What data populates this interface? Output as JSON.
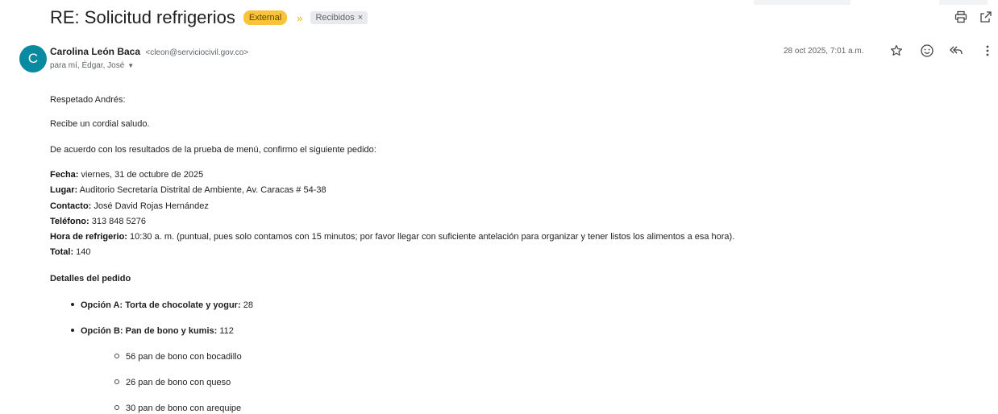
{
  "email": {
    "subject": "RE: Solicitud refrigerios",
    "external_tag": "External",
    "label": "Recibidos",
    "label_close": "×",
    "sender_initial": "C",
    "sender_name": "Carolina León Baca",
    "sender_email": "<cleon@serviciocivil.gov.co>",
    "recipients": "para mí, Édgar, José",
    "date": "28 oct 2025, 7:01 a.m."
  },
  "icons": {
    "print": "print-icon",
    "popout": "open-in-new-window-icon",
    "star": "star-icon",
    "emoji": "emoji-icon",
    "reply_all": "reply-all-icon",
    "more": "more-vertical-icon",
    "accent_external": "#f9c43a",
    "avatar_color": "#0a8aa0"
  },
  "body": {
    "greeting": "Respetado Andrés:",
    "salutation": "Recibe un cordial saludo.",
    "intro": "De acuerdo con los resultados de la prueba de menú, confirmo el siguiente pedido:",
    "fields": [
      {
        "label": "Fecha:",
        "value": " viernes, 31 de octubre de 2025"
      },
      {
        "label": "Lugar:",
        "value": " Auditorio Secretaría Distrital de Ambiente, Av. Caracas # 54-38"
      },
      {
        "label": "Contacto:",
        "value": " José David Rojas Hernández"
      },
      {
        "label": "Teléfono:",
        "value": " 313 848 5276"
      },
      {
        "label": "Hora de refrigerio:",
        "value": " 10:30 a. m. (puntual, pues solo contamos con 15 minutos; por favor llegar con suficiente antelación para organizar y tener listos los alimentos a esa hora)."
      },
      {
        "label": "Total:",
        "value": " 140"
      }
    ],
    "details_title": "Detalles del pedido",
    "options": [
      {
        "label": "Opción A: Torta de chocolate y yogur:",
        "value": " 28"
      },
      {
        "label": "Opción B: Pan de bono y kumis:",
        "value": " 112"
      }
    ],
    "sub_items": [
      "56 pan de bono con bocadillo",
      "26 pan de bono con queso",
      "30 pan de bono con arequipe"
    ]
  }
}
